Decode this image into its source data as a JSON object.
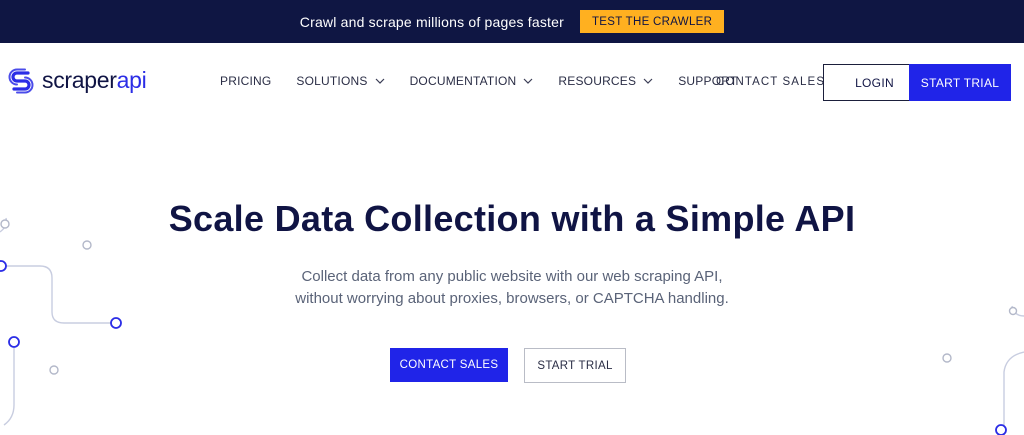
{
  "announcement": {
    "text": "Crawl and scrape millions of pages faster",
    "cta": "TEST THE CRAWLER"
  },
  "header": {
    "logo": {
      "prefix": "scraper",
      "accent": "api",
      "icon": "scraperapi-logo-icon"
    },
    "nav": [
      {
        "label": "PRICING",
        "has_dropdown": false
      },
      {
        "label": "SOLUTIONS",
        "has_dropdown": true
      },
      {
        "label": "DOCUMENTATION",
        "has_dropdown": true
      },
      {
        "label": "RESOURCES",
        "has_dropdown": true
      },
      {
        "label": "SUPPORT",
        "has_dropdown": false
      }
    ],
    "contact_sales": "CONTACT SALES",
    "login": "LOGIN",
    "start_trial": "START TRIAL"
  },
  "hero": {
    "title": "Scale Data Collection with a Simple API",
    "subtitle_line1": "Collect data from any public website with our web scraping API,",
    "subtitle_line2": "without worrying about proxies, browsers, or CAPTCHA handling.",
    "primary_cta": "CONTACT SALES",
    "secondary_cta": "START TRIAL"
  },
  "colors": {
    "navy": "#0f1643",
    "brand_blue": "#2024e8",
    "highlight": "#ffb020",
    "text_muted": "#5a6378"
  }
}
